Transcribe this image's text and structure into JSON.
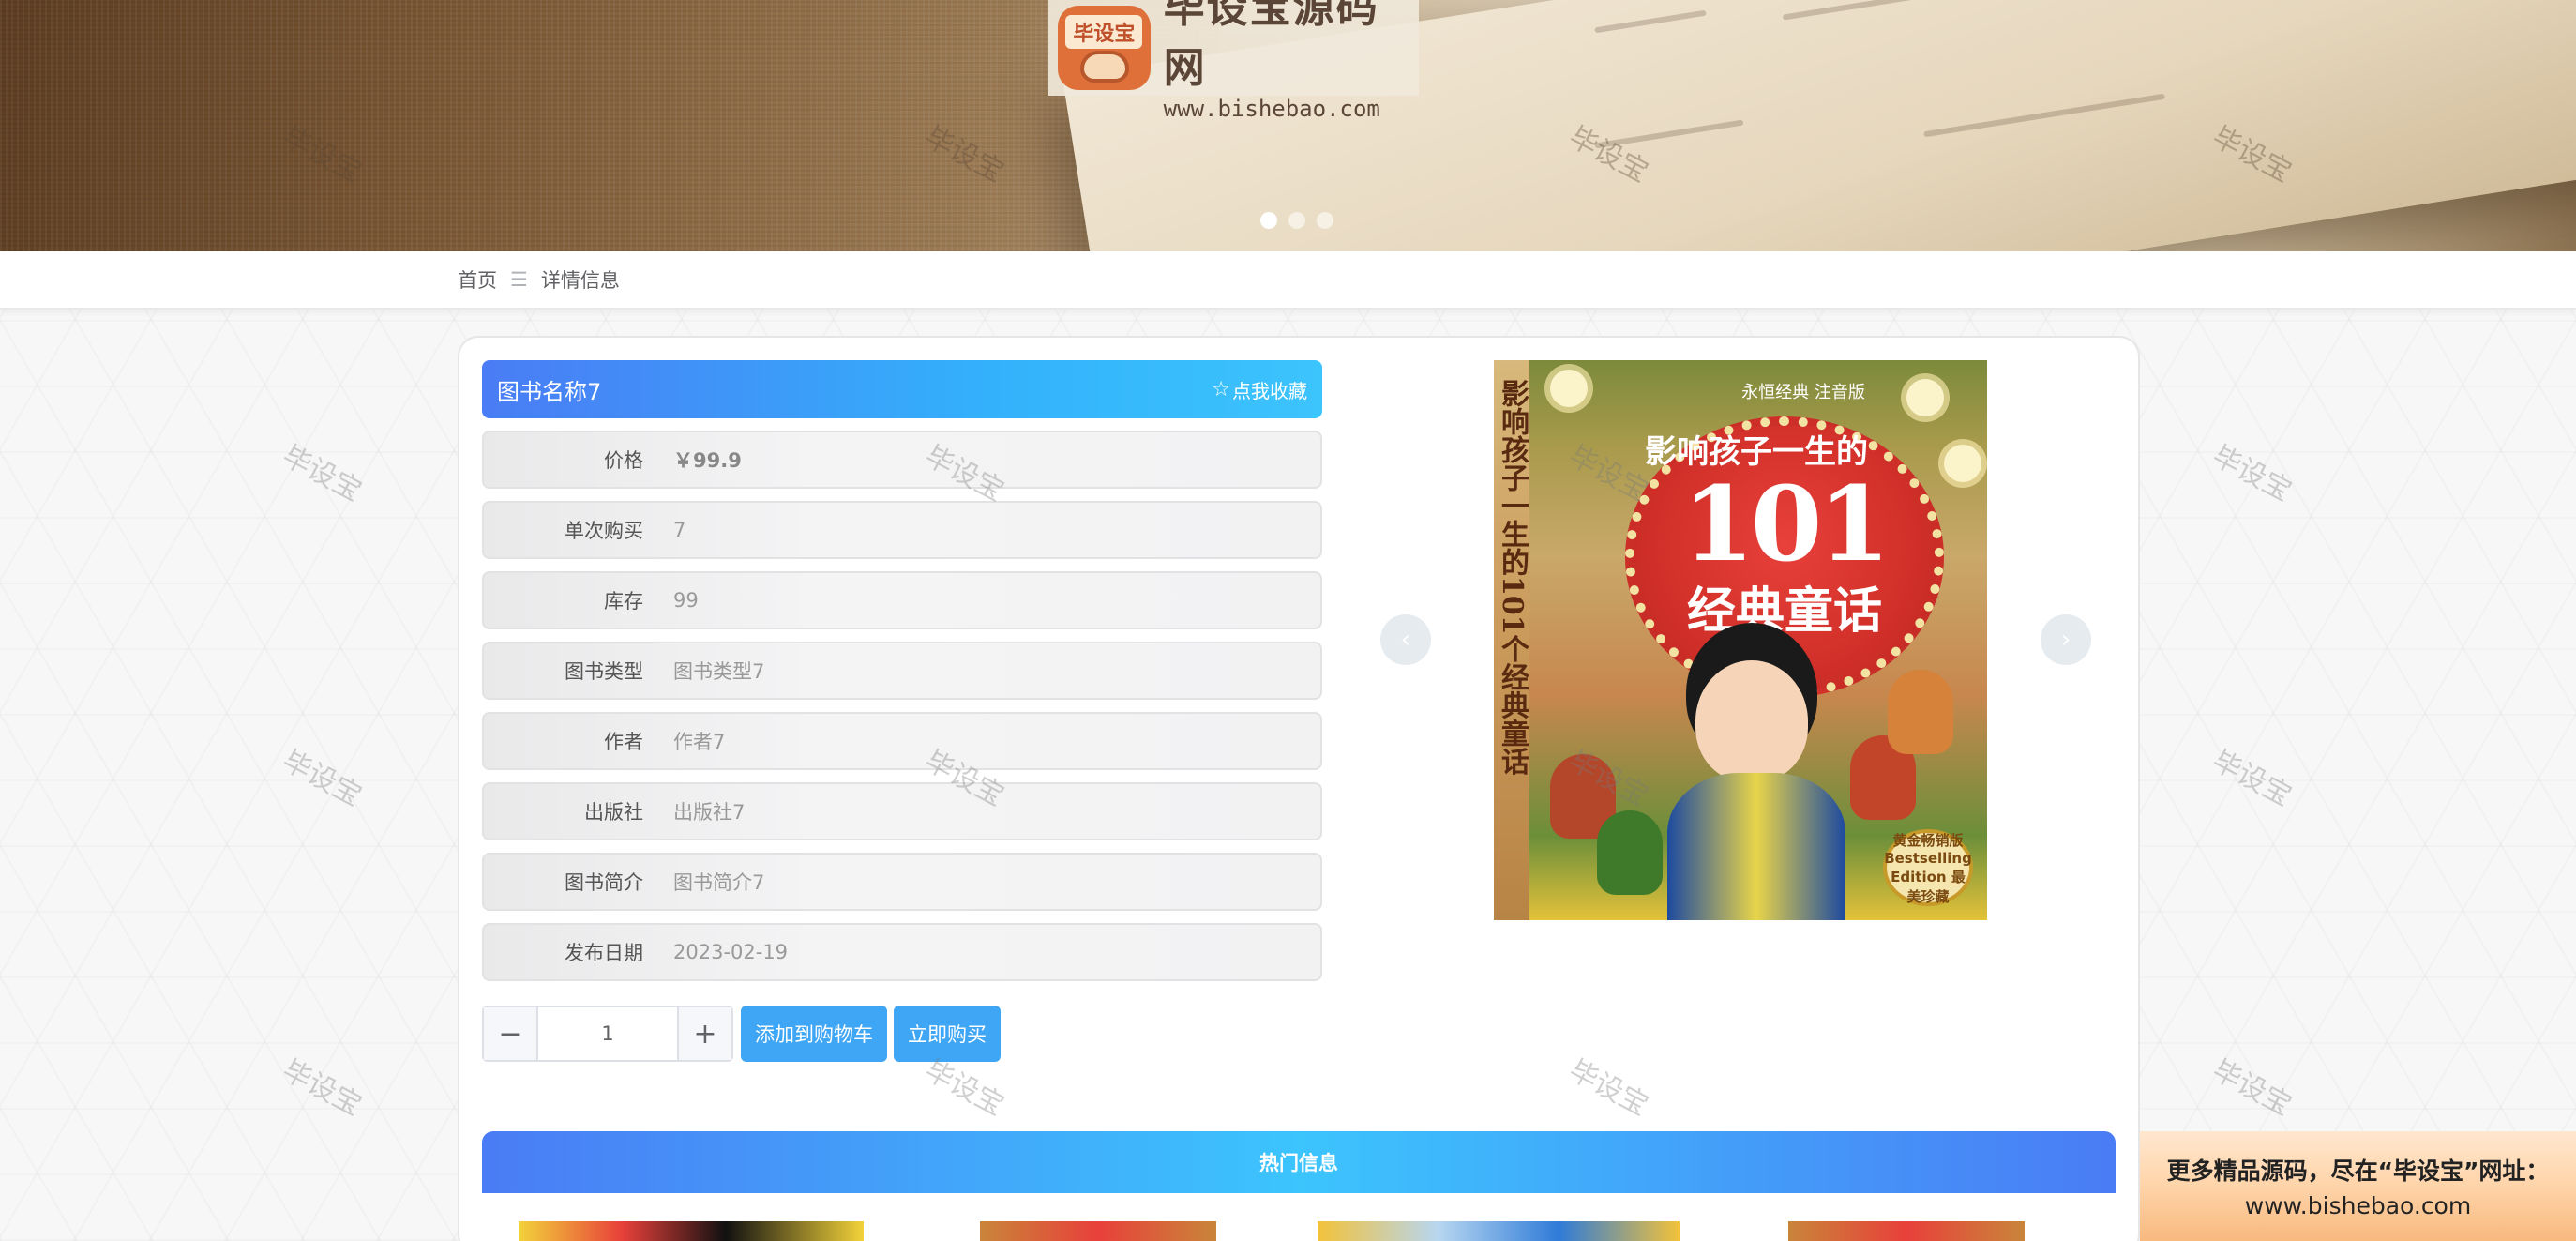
{
  "banner": {
    "logo_title": "毕设宝源码网",
    "logo_url": "www.bishebao.com",
    "logo_badge": "毕设宝",
    "slides": 3,
    "active_slide": 1
  },
  "breadcrumb": {
    "home": "首页",
    "separator": "☰",
    "current": "详情信息"
  },
  "detail": {
    "title": "图书名称7",
    "favorite_label": "点我收藏",
    "fields": [
      {
        "label": "价格",
        "value": "￥99.9"
      },
      {
        "label": "单次购买",
        "value": "7"
      },
      {
        "label": "库存",
        "value": "99"
      },
      {
        "label": "图书类型",
        "value": "图书类型7"
      },
      {
        "label": "作者",
        "value": "作者7"
      },
      {
        "label": "出版社",
        "value": "出版社7"
      },
      {
        "label": "图书简介",
        "value": "图书简介7"
      },
      {
        "label": "发布日期",
        "value": "2023-02-19"
      }
    ]
  },
  "purchase": {
    "quantity": "1",
    "minus": "−",
    "plus": "+",
    "add_to_cart": "添加到购物车",
    "buy_now": "立即购买"
  },
  "gallery": {
    "prev": "‹",
    "next": "›",
    "cover": {
      "top_line": "永恒经典 注音版",
      "subtitle": "影响孩子一生的",
      "number": "101",
      "title": "经典童话",
      "spine": "影响孩子一生的101个经典童话",
      "seal": "黄金畅销版 Bestselling Edition 最美珍藏"
    }
  },
  "hot": {
    "title": "热门信息"
  },
  "watermark": "毕设宝",
  "ad": {
    "line1": "更多精品源码，尽在“毕设宝”网址：",
    "line2": "www.bishebao.com"
  },
  "colors": {
    "accent_blue": "#3fa6f5",
    "title_gradient_start": "#4a7cf5",
    "title_gradient_end": "#3cc4fd"
  }
}
